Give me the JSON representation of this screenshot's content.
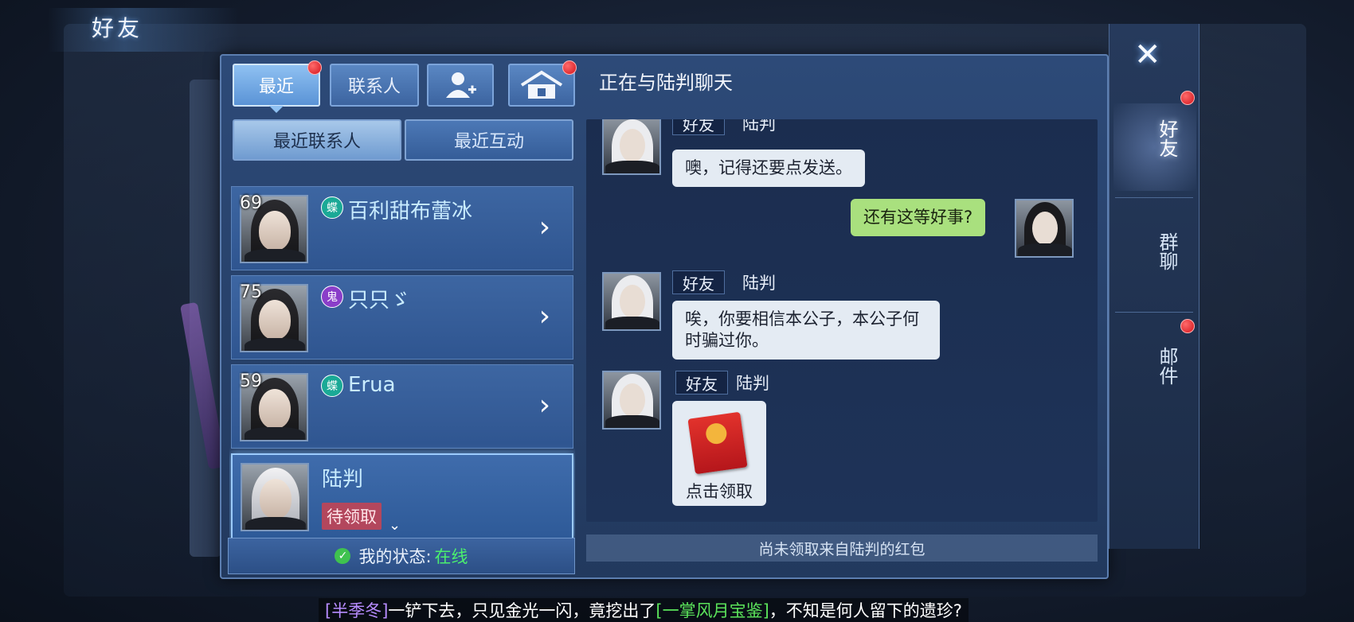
{
  "header": {
    "title": "好友"
  },
  "tabs": [
    {
      "label": "最近",
      "active": true,
      "badge": true
    },
    {
      "label": "联系人",
      "active": false,
      "badge": false
    },
    {
      "icon": "add-friend-icon",
      "active": false,
      "badge": false
    },
    {
      "icon": "home-icon",
      "active": false,
      "badge": true
    }
  ],
  "chat_title": "正在与陆判聊天",
  "subtabs": [
    {
      "label": "最近联系人",
      "active": true
    },
    {
      "label": "最近互动",
      "active": false
    }
  ],
  "contacts": [
    {
      "level": "69",
      "sect": "蝶",
      "sect_color": "#1aa996",
      "name": "百利甜布蕾冰"
    },
    {
      "level": "75",
      "sect": "鬼",
      "sect_color": "#8a3ec9",
      "name": "只只ゞ"
    },
    {
      "level": "59",
      "sect": "蝶",
      "sect_color": "#1aa996",
      "name": "Erua"
    },
    {
      "name": "陆判",
      "status_tag": "待领取",
      "selected": true
    }
  ],
  "my_status": {
    "label": "我的状态:",
    "value": "在线"
  },
  "messages": [
    {
      "from": "friend",
      "tag": "好友",
      "sender": "陆判",
      "text": "噢，记得还要点发送。"
    },
    {
      "from": "me",
      "text": "还有这等好事?"
    },
    {
      "from": "friend",
      "tag": "好友",
      "sender": "陆判",
      "text": "唉，你要相信本公子，本公子何时骗过你。"
    },
    {
      "from": "friend",
      "tag": "好友",
      "sender": "陆判",
      "redpacket_label": "点击领取"
    }
  ],
  "notice": "尚未领取来自陆判的红包",
  "side_nav": [
    {
      "label": "好友",
      "active": true,
      "badge": true
    },
    {
      "label": "群聊",
      "active": false,
      "badge": false
    },
    {
      "label": "邮件",
      "active": false,
      "badge": true
    }
  ],
  "marquee": {
    "name": "[半季冬]",
    "text1": "一铲下去，只见金光一闪，竟挖出了",
    "item": "[一掌风月宝鉴]",
    "text2": "，不知是何人留下的遗珍?"
  },
  "colors": {
    "accent": "#8fc1f2",
    "online": "#4bef6e",
    "my_bubble": "#a9e07e",
    "badge": "#d3141c"
  }
}
